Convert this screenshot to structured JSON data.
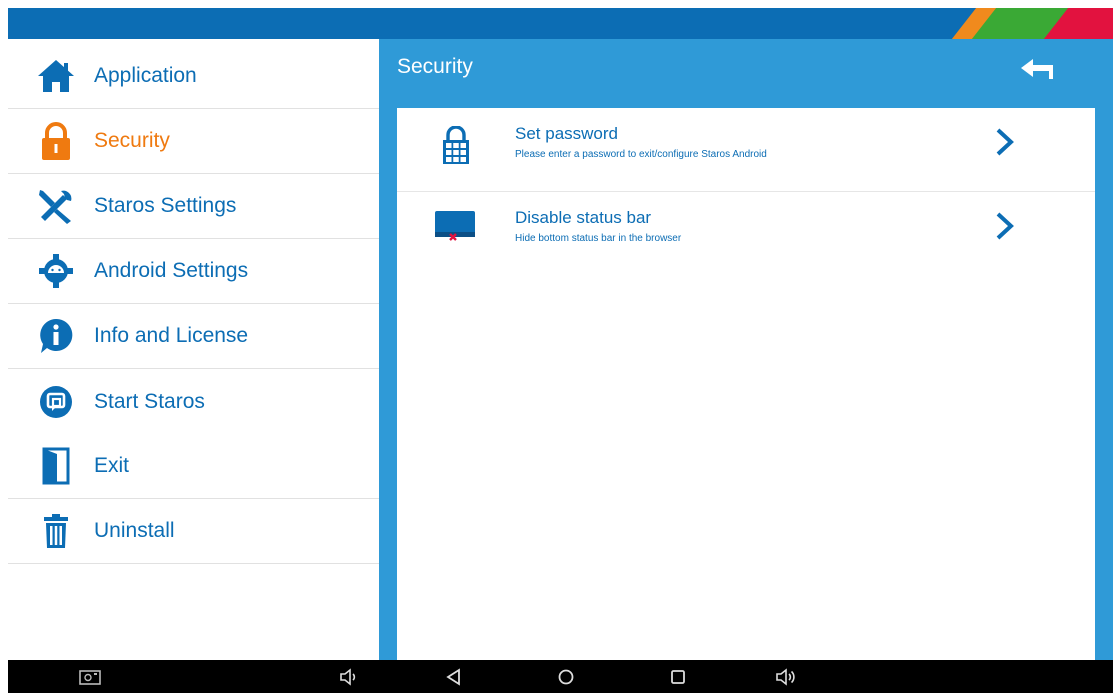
{
  "sidebar": {
    "items": [
      {
        "label": "Application",
        "icon": "home-icon"
      },
      {
        "label": "Security",
        "icon": "lock-icon",
        "active": true
      },
      {
        "label": "Staros Settings",
        "icon": "tools-icon"
      },
      {
        "label": "Android Settings",
        "icon": "android-gear-icon"
      },
      {
        "label": "Info and License",
        "icon": "info-icon"
      },
      {
        "label": "Start Staros",
        "icon": "start-staros-icon"
      },
      {
        "label": "Exit",
        "icon": "exit-door-icon"
      },
      {
        "label": "Uninstall",
        "icon": "trash-icon"
      }
    ]
  },
  "content": {
    "title": "Security",
    "rows": [
      {
        "title": "Set password",
        "description": "Please enter a password to exit/configure Staros Android",
        "icon": "keypad-lock-icon"
      },
      {
        "title": "Disable status bar",
        "description": "Hide bottom status bar in the browser",
        "icon": "screen-statusbar-icon"
      }
    ]
  },
  "colors": {
    "topbar": "#0c6db4",
    "accent_blue": "#0c6db4",
    "content_blue": "#2f9ad7",
    "active_orange": "#ef7a10"
  },
  "navbar": {
    "buttons": [
      "screenshot-icon",
      "volume-down-icon",
      "back-icon",
      "home-circle-icon",
      "recents-icon",
      "volume-up-icon"
    ]
  }
}
